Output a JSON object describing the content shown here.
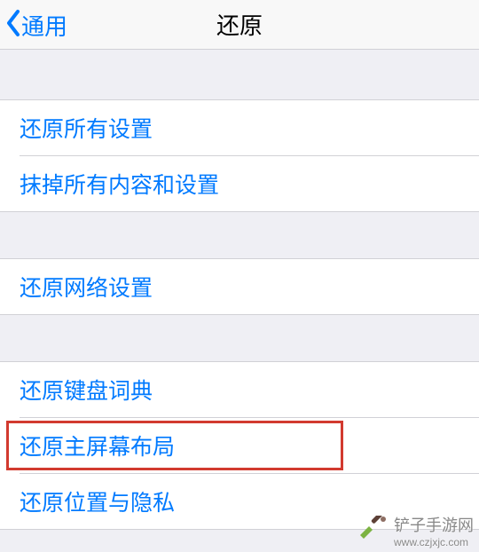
{
  "nav": {
    "back_label": "通用",
    "title": "还原"
  },
  "groups": [
    {
      "items": [
        {
          "label": "还原所有设置"
        },
        {
          "label": "抹掉所有内容和设置"
        }
      ]
    },
    {
      "items": [
        {
          "label": "还原网络设置"
        }
      ]
    },
    {
      "items": [
        {
          "label": "还原键盘词典"
        },
        {
          "label": "还原主屏幕布局"
        },
        {
          "label": "还原位置与隐私"
        }
      ]
    }
  ],
  "highlight": {
    "targets_label": "还原主屏幕布局"
  },
  "watermark": {
    "text": "铲子手游网",
    "url": "www.czjxjc.com"
  },
  "colors": {
    "accent": "#007aff",
    "highlight_border": "#d23a2f",
    "background": "#efeff4"
  }
}
